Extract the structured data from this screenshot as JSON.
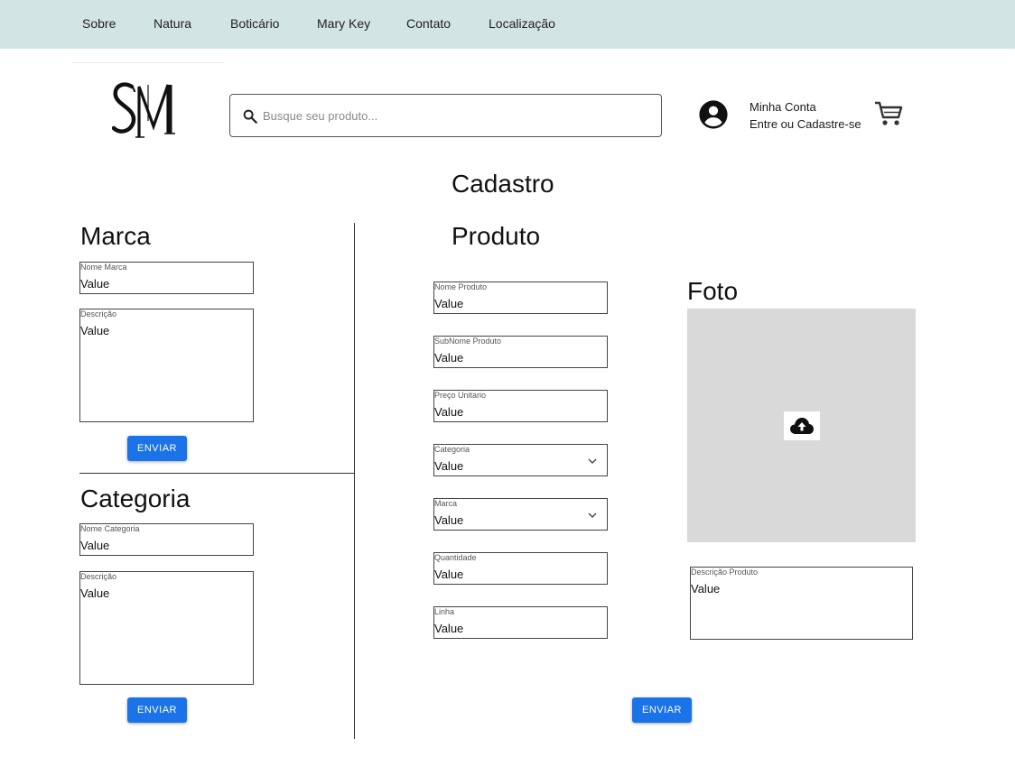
{
  "nav": {
    "items": [
      "Sobre",
      "Natura",
      "Boticário",
      "Mary Key",
      "Contato",
      "Localização"
    ]
  },
  "search": {
    "placeholder": "Busque seu produto..."
  },
  "account": {
    "title": "Minha Conta",
    "subtitle": "Entre ou Cadastre-se"
  },
  "page_title": "Cadastro",
  "marca": {
    "heading": "Marca",
    "nome_label": "Nome Marca",
    "nome_value": "Value",
    "descricao_label": "Descrição",
    "descricao_value": "Value",
    "submit": "ENVIAR"
  },
  "categoria": {
    "heading": "Categoria",
    "nome_label": "Nome Categoria",
    "nome_value": "Value",
    "descricao_label": "Descrição",
    "descricao_value": "Value",
    "submit": "ENVIAR"
  },
  "produto": {
    "heading": "Produto",
    "fields": [
      {
        "label": "Nome Produto",
        "value": "Value"
      },
      {
        "label": "SubNome Produto",
        "value": "Value"
      },
      {
        "label": "Preço Unitario",
        "value": "Value"
      },
      {
        "label": "Categoria",
        "value": "Value"
      },
      {
        "label": "Marca",
        "value": "Value"
      },
      {
        "label": "Quantidade",
        "value": "Value"
      },
      {
        "label": "Linha",
        "value": "Value"
      }
    ],
    "foto_heading": "Foto",
    "descricao_label": "Descrição Produto",
    "descricao_value": "Value",
    "submit": "ENVIAR"
  },
  "colors": {
    "nav_bg": "#d3e4e4",
    "button": "#1a73e8",
    "photo_bg": "#d9d9d9"
  },
  "icons": [
    "search-icon",
    "account-circle-icon",
    "cart-icon",
    "chevron-down-icon",
    "cloud-upload-icon"
  ]
}
